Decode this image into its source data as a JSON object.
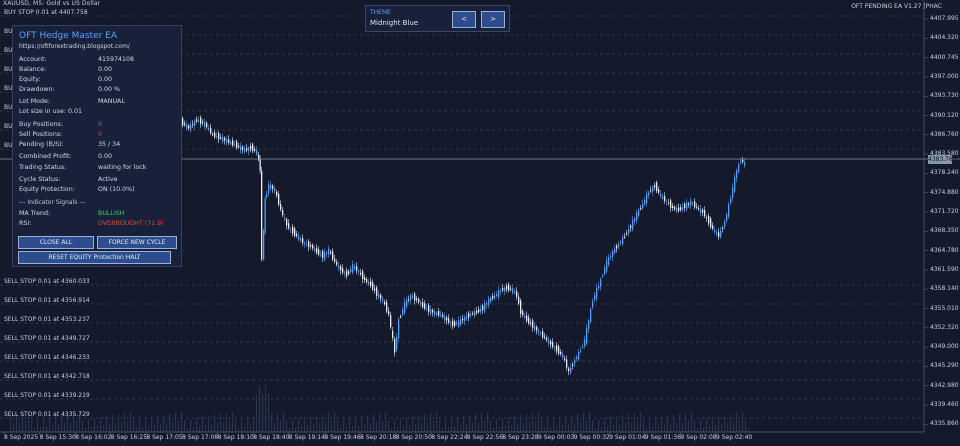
{
  "chart_info": {
    "symbol_line": "XAUUSD, M5:  Gold vs US Dollar",
    "ea_name": "OFT PENDING EA V1.27 [PHAC"
  },
  "theme": {
    "label": "THEME",
    "name": "Midnight Blue",
    "prev_label": "<",
    "next_label": ">"
  },
  "current_price_label": "4383.765",
  "order_lines": {
    "buy": [
      {
        "text": "BUY STOP 0.01 at 4407.758"
      },
      {
        "text": "BU"
      },
      {
        "text": "BU"
      },
      {
        "text": "BU"
      },
      {
        "text": "BU"
      },
      {
        "text": "BU"
      },
      {
        "text": "BU"
      },
      {
        "text": "BU"
      }
    ],
    "sell": [
      {
        "text": "SELL STOP 0.01 at 4360.033"
      },
      {
        "text": "SELL STOP 0.01 at 4356.914"
      },
      {
        "text": "SELL STOP 0.01 at 4353.237"
      },
      {
        "text": "SELL STOP 0.01 at 4349.727"
      },
      {
        "text": "SELL STOP 0.01 at 4346.233"
      },
      {
        "text": "SELL STOP 0.01 at 4342.718"
      },
      {
        "text": "SELL STOP 0.01 at 4339.219"
      },
      {
        "text": "SELL STOP 0.01 at 4335.729"
      }
    ]
  },
  "y_axis_labels": [
    "4407.995",
    "4404.320",
    "4400.745",
    "4397.000",
    "4393.730",
    "4390.120",
    "4386.760",
    "4383.580",
    "4378.240",
    "4374.880",
    "4371.720",
    "4368.350",
    "4364.780",
    "4361.590",
    "4358.140",
    "4355.010",
    "4352.320",
    "4349.000",
    "4345.290",
    "4342.980",
    "4339.460",
    "4335.860"
  ],
  "x_axis_labels": [
    "8 Sep 2025",
    "8 Sep 15:30",
    "8 Sep 16:02",
    "8 Sep 16:25",
    "8 Sep 17:05",
    "8 Sep 17:08",
    "8 Sep 18:10",
    "8 Sep 18:40",
    "8 Sep 19:14",
    "8 Sep 19:46",
    "8 Sep 20:18",
    "8 Sep 20:50",
    "8 Sep 22:24",
    "8 Sep 22:56",
    "8 Sep 23:28",
    "9 Sep 00:03",
    "9 Sep 00:32",
    "9 Sep 01:04",
    "9 Sep 01:36",
    "9 Sep 02:08",
    "9 Sep 02:40"
  ],
  "panel": {
    "title": "OFT Hedge Master EA",
    "url": "https://oftforextrading.blogspot.com/",
    "account": {
      "label": "Account:",
      "value": "415974108"
    },
    "balance": {
      "label": "Balance:",
      "value": "0.00"
    },
    "equity": {
      "label": "Equity:",
      "value": "0.00"
    },
    "drawdown": {
      "label": "Drawdown:",
      "value": "0.00 %"
    },
    "lot_mode": {
      "label": "Lot Mode:",
      "value": "MANUAL"
    },
    "lot_size": {
      "label": "Lot size in use: 0.01"
    },
    "buy_positions": {
      "label": "Buy Positions:",
      "value": "0"
    },
    "sell_positions": {
      "label": "Sell Positions:",
      "value": "0"
    },
    "pending": {
      "label": "Pending (B/S):",
      "value": "35 / 34"
    },
    "combined_profit": {
      "label": "Combined Profit:",
      "value": "0.00"
    },
    "trading_status": {
      "label": "Trading Status:",
      "value": "waiting for lock"
    },
    "cycle_status": {
      "label": "Cycle Status:",
      "value": "Active"
    },
    "equity_protection": {
      "label": "Equity Protection:",
      "value": "ON (10.0%)"
    },
    "indicator_title": "--- Indicator Signals ---",
    "ma_trend": {
      "label": "MA Trend:",
      "value": "BULLISH"
    },
    "rsi": {
      "label": "RSI:",
      "value": "OVERBOUGHT (71.9)"
    },
    "close_all_label": "CLOSE ALL",
    "force_cycle_label": "FORCE NEW CYCLE",
    "reset_equity_label": "RESET EQUITY Protection HALT"
  },
  "colors": {
    "background": "#141a2b",
    "candle_bull": "#5b9cf5",
    "candle_bear": "#e8ecf4",
    "accent": "#5aa2ff",
    "bullish": "#39d15b",
    "bearish": "#e04a3c"
  }
}
